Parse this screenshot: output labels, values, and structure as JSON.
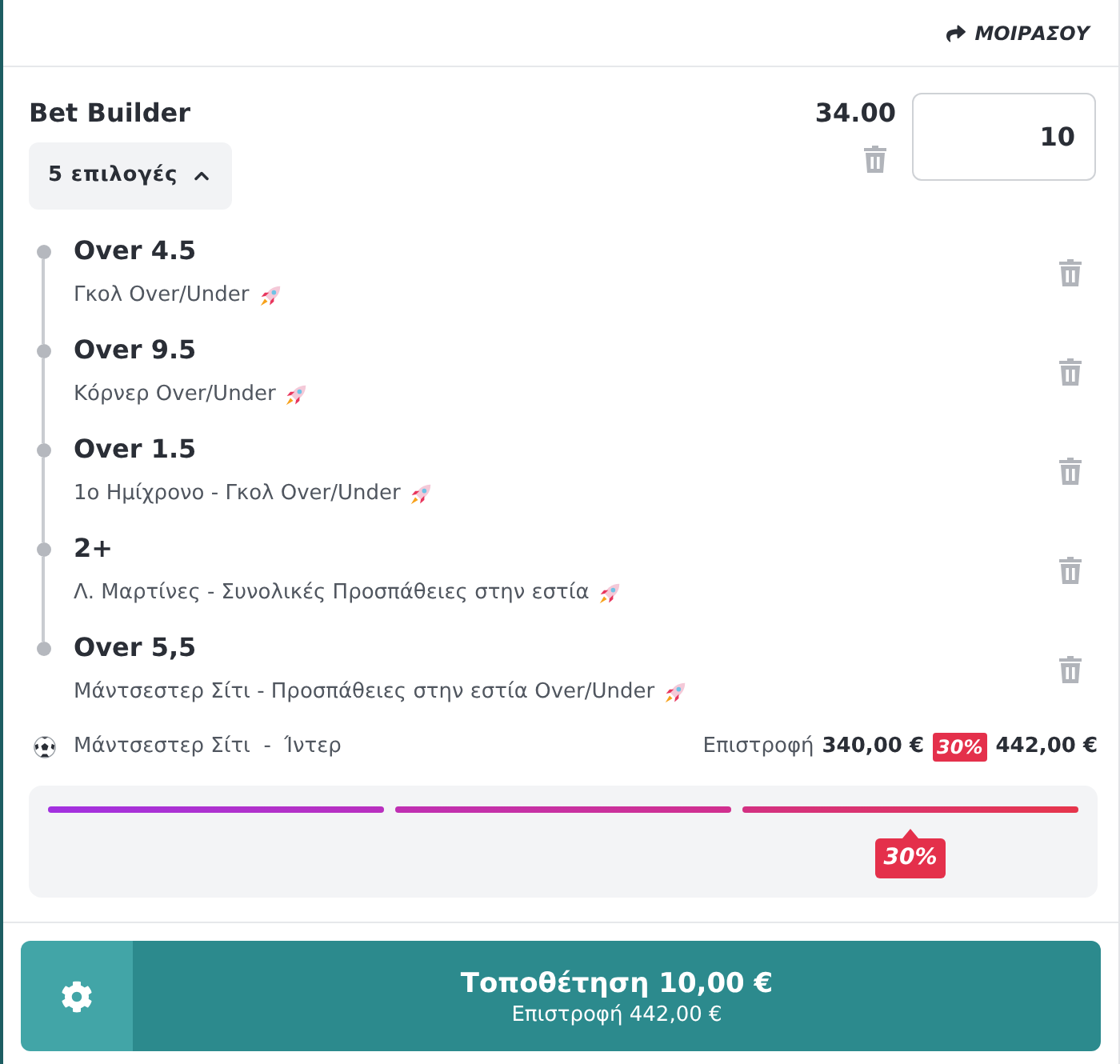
{
  "header": {
    "share_label": "ΜΟΙΡΑΣΟΥ"
  },
  "bet": {
    "title": "Bet Builder",
    "odds": "34.00",
    "stake": "10",
    "selections_toggle": {
      "label": "5 επιλογές",
      "expanded": true
    }
  },
  "selections": [
    {
      "value": "Over 4.5",
      "market": "Γκολ Over/Under",
      "boosted": true
    },
    {
      "value": "Over 9.5",
      "market": "Κόρνερ Over/Under",
      "boosted": true
    },
    {
      "value": "Over 1.5",
      "market": "1ο Ημίχρονο - Γκολ Over/Under",
      "boosted": true
    },
    {
      "value": "2+",
      "market": "Λ. Μαρτίνες - Συνολικές Προσπάθειες στην εστία",
      "boosted": true
    },
    {
      "value": "Over 5,5",
      "market": "Μάντσεστερ Σίτι - Προσπάθειες στην εστία Over/Under",
      "boosted": true
    }
  ],
  "match": {
    "name": "Μάντσεστερ Σίτι  -  Ίντερ",
    "return_label": "Επιστροφή",
    "return_amount": "340,00 €",
    "boost_badge": "30%",
    "boosted_return": "442,00 €"
  },
  "boost_progress": {
    "segments": [
      {
        "level": 1
      },
      {
        "level": 1
      },
      {
        "level": 1
      }
    ],
    "tooltip": "30%"
  },
  "place_bet": {
    "label": "Τοποθέτηση 10,00 €",
    "sublabel": "Επιστροφή 442,00 €"
  }
}
